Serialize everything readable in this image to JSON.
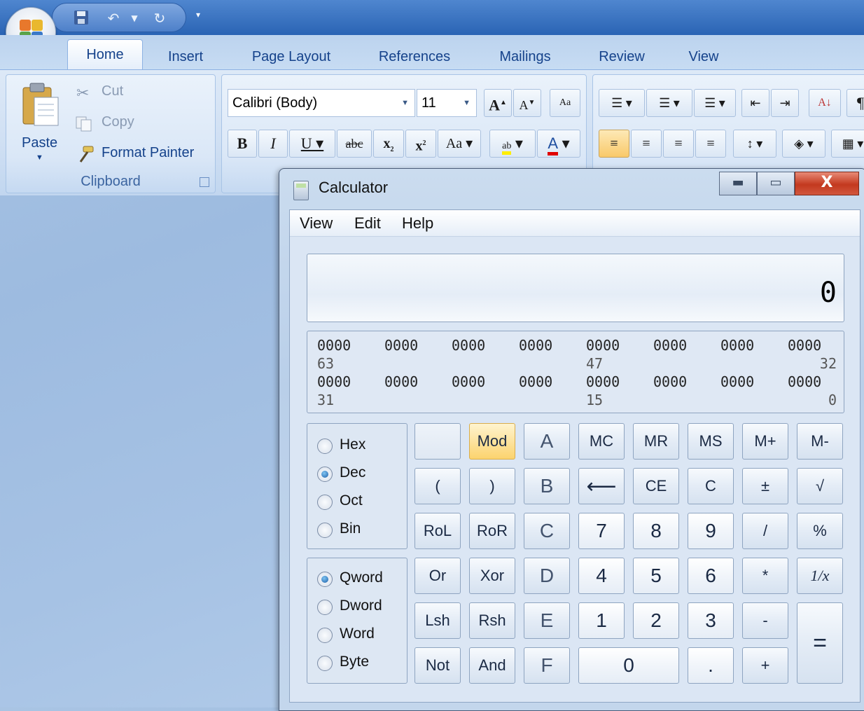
{
  "word": {
    "tabs": [
      "Home",
      "Insert",
      "Page Layout",
      "References",
      "Mailings",
      "Review",
      "View"
    ],
    "active_tab": "Home",
    "clipboard": {
      "paste": "Paste",
      "cut": "Cut",
      "copy": "Copy",
      "format_painter": "Format Painter",
      "group_label": "Clipboard"
    },
    "font": {
      "family": "Calibri (Body)",
      "size": "11"
    }
  },
  "calculator": {
    "title": "Calculator",
    "menu": [
      "View",
      "Edit",
      "Help"
    ],
    "display": "0",
    "bits": {
      "row1": [
        "0000",
        "0000",
        "0000",
        "0000",
        "0000",
        "0000",
        "0000",
        "0000"
      ],
      "row1_labels": [
        "63",
        "47",
        "32"
      ],
      "row2": [
        "0000",
        "0000",
        "0000",
        "0000",
        "0000",
        "0000",
        "0000",
        "0000"
      ],
      "row2_labels": [
        "31",
        "15",
        "0"
      ]
    },
    "base_options": [
      "Hex",
      "Dec",
      "Oct",
      "Bin"
    ],
    "base_selected": "Dec",
    "word_options": [
      "Qword",
      "Dword",
      "Word",
      "Byte"
    ],
    "word_selected": "Qword",
    "keys": {
      "row1": [
        "",
        "Mod",
        "A",
        "MC",
        "MR",
        "MS",
        "M+",
        "M-"
      ],
      "row2": [
        "(",
        ")",
        "B",
        "⟵",
        "CE",
        "C",
        "±",
        "√"
      ],
      "row3": [
        "RoL",
        "RoR",
        "C",
        "7",
        "8",
        "9",
        "/",
        "%"
      ],
      "row4": [
        "Or",
        "Xor",
        "D",
        "4",
        "5",
        "6",
        "*",
        "1/x"
      ],
      "row5": [
        "Lsh",
        "Rsh",
        "E",
        "1",
        "2",
        "3",
        "-",
        "="
      ],
      "row6": [
        "Not",
        "And",
        "F",
        "0",
        ".",
        "+"
      ]
    }
  }
}
